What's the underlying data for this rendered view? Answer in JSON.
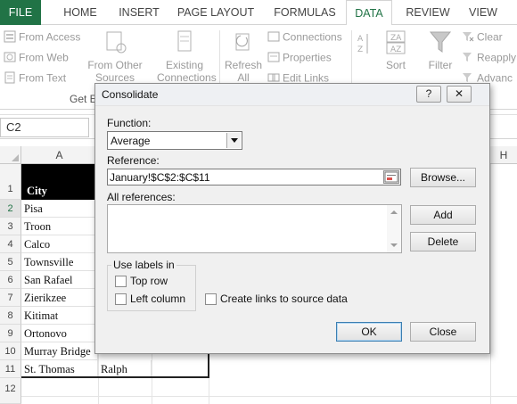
{
  "ribbon_tabs": {
    "file": "FILE",
    "home": "HOME",
    "insert": "INSERT",
    "page_layout": "PAGE LAYOUT",
    "formulas": "FORMULAS",
    "data": "DATA",
    "review": "REVIEW",
    "view": "VIEW"
  },
  "ribbon": {
    "from_access": "From Access",
    "from_web": "From Web",
    "from_text": "From Text",
    "from_other_sources": "From Other",
    "from_other_sources_2": "Sources",
    "existing_connections": "Existing",
    "existing_connections_2": "Connections",
    "refresh_all": "Refresh",
    "refresh_all_2": "All",
    "connections": "Connections",
    "properties": "Properties",
    "edit_links": "Edit Links",
    "sort": "Sort",
    "filter": "Filter",
    "clear": "Clear",
    "reapply": "Reapply",
    "advanced": "Advanc",
    "get_external_data_group": "Get E"
  },
  "formula_bar": {
    "name_box": "C2"
  },
  "grid": {
    "column_headers": [
      "A",
      "H"
    ],
    "row_numbers": [
      "1",
      "2",
      "3",
      "4",
      "5",
      "6",
      "7",
      "8",
      "9",
      "10",
      "11",
      "12"
    ],
    "column_a": [
      "City",
      "Pisa",
      "Troon",
      "Calco",
      "Townsville",
      "San Rafael",
      "Zierikzee",
      "Kitimat",
      "Ortonovo",
      "Murray Bridge",
      "St. Thomas"
    ],
    "column_b_row11": "Ralph"
  },
  "dialog": {
    "title": "Consolidate",
    "help_button": "?",
    "close_button": "✕",
    "function_label": "Function:",
    "function_value": "Average",
    "reference_label": "Reference:",
    "reference_value": "January!$C$2:$C$11",
    "all_references_label": "All references:",
    "browse_button": "Browse...",
    "add_button": "Add",
    "delete_button": "Delete",
    "use_labels_in": "Use labels in",
    "top_row": "Top row",
    "left_column": "Left column",
    "create_links": "Create links to source data",
    "ok_button": "OK",
    "close_dialog_button": "Close"
  },
  "colors": {
    "file_tab": "#217346",
    "active_tab_text": "#217346",
    "header_row_fill": "#000000"
  }
}
